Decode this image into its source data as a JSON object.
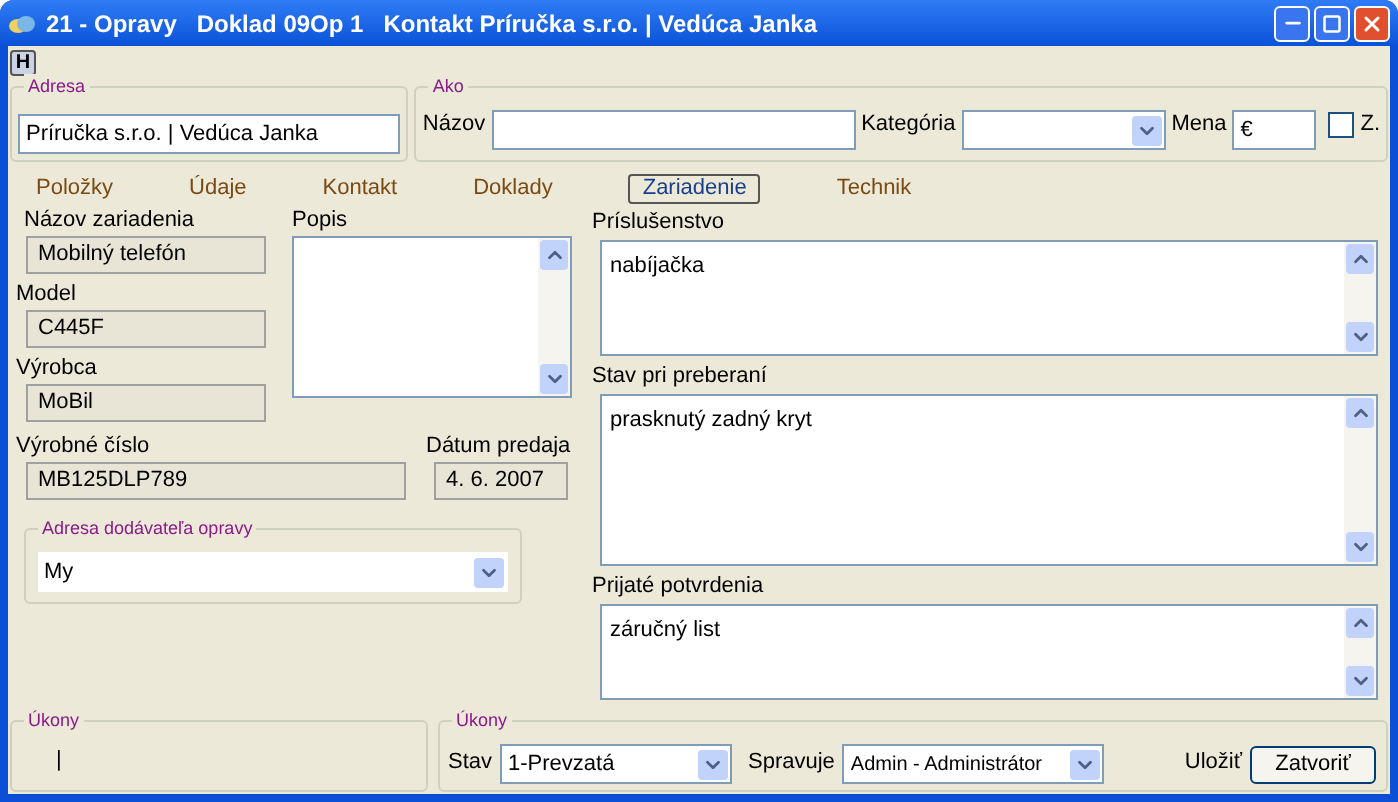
{
  "window": {
    "title": "21 - Opravy   Doklad 09Op 1   Kontakt Príručka s.r.o. | Vedúca Janka"
  },
  "toolbar": {
    "help_button": "H"
  },
  "adresa": {
    "legend": "Adresa",
    "value": "Príručka s.r.o. | Vedúca Janka"
  },
  "ako": {
    "legend": "Ako",
    "name_label": "Názov",
    "category_label": "Kategória",
    "currency_label": "Mena",
    "currency_value": "€",
    "checkbox": {
      "label": "Z.",
      "checked": false
    }
  },
  "tabs": [
    {
      "label": "Položky",
      "selected": false
    },
    {
      "label": "Údaje",
      "selected": false
    },
    {
      "label": "Kontakt",
      "selected": false
    },
    {
      "label": "Doklady",
      "selected": false
    },
    {
      "label": "Zariadenie",
      "selected": true
    },
    {
      "label": "Technik",
      "selected": false
    }
  ],
  "device": {
    "fields": [
      {
        "label": "Názov zariadenia",
        "value": "Mobilný telefón"
      },
      {
        "label": "Model",
        "value": "C445F"
      },
      {
        "label": "Výrobca",
        "value": "MoBil"
      }
    ],
    "description_label": "Popis",
    "serial": {
      "label": "Výrobné číslo",
      "value": "MB125DLP789"
    },
    "sale_date": {
      "label": "Dátum predaja",
      "value": "4. 6. 2007"
    },
    "supplier": {
      "legend": "Adresa dodávateľa opravy",
      "value": "My"
    }
  },
  "notes": [
    {
      "label": "Príslušenstvo",
      "value": "nabíjačka"
    },
    {
      "label": "Stav pri preberaní",
      "value": "prasknutý zadný kryt"
    },
    {
      "label": "Prijaté potvrdenia",
      "value": "záručný list"
    }
  ],
  "bottom": {
    "left_legend": "Úkony",
    "left_value": "|",
    "right_legend": "Úkony",
    "status_label": "Stav",
    "status_value": "1-Prevzatá",
    "manager_label": "Spravuje",
    "manager_value": "Admin - Administrátor",
    "save_button": "Uložiť",
    "close_button": "Zatvoriť"
  }
}
